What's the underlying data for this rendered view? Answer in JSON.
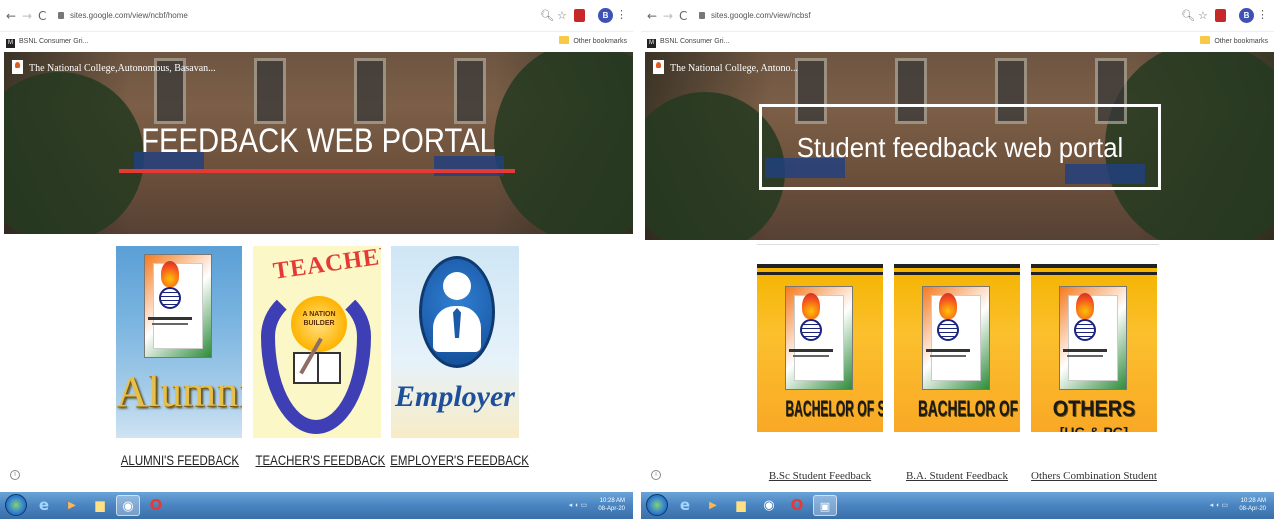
{
  "left": {
    "url": "sites.google.com/view/ncbf/home",
    "bookmark": "BSNL Consumer Gri...",
    "other_bookmarks": "Other bookmarks",
    "profile_initial": "B",
    "site_name": "The National College,Autonomous, Basavan...",
    "hero_title": "FEEDBACK WEB PORTAL",
    "cards": [
      {
        "image_text": "Alumni",
        "caption": "ALUMNI'S FEEDBACK"
      },
      {
        "image_text": "TEACHER",
        "sub_text": "A NATION BUILDER",
        "caption": "TEACHER'S FEEDBACK"
      },
      {
        "image_text": "Employer",
        "caption": "EMPLOYER'S FEEDBACK"
      }
    ]
  },
  "right": {
    "url": "sites.google.com/view/ncbsf",
    "bookmark": "BSNL Consumer Gri...",
    "other_bookmarks": "Other bookmarks",
    "profile_initial": "B",
    "site_name": "The National College, Antono...",
    "hero_title": "Student feedback web portal",
    "cards": [
      {
        "image_text": "BACHELOR OF SCIENCE",
        "caption": "B.Sc Student Feedback"
      },
      {
        "image_text": "BACHELOR OF ARTS",
        "caption": "B.A. Student Feedback"
      },
      {
        "image_text": "OTHERS",
        "sub_text": "[UG & PG]",
        "caption": "Others Combination Student"
      }
    ]
  },
  "taskbar": {
    "time": "10:28 AM",
    "date": "08-Apr-20"
  },
  "icons": {
    "back": "arrow-left-icon",
    "forward": "arrow-right-icon",
    "reload": "reload-icon",
    "lock": "lock-icon",
    "zoom": "magnifier-icon",
    "star": "star-icon",
    "menu": "kebab-menu-icon",
    "folder": "folder-icon",
    "info": "info-icon"
  },
  "colors": {
    "accent_red": "#e53935",
    "taskbar_blue": "#4a84c0",
    "course_yellow": "#f4b400",
    "alumni_blue": "#5a9fd6"
  }
}
